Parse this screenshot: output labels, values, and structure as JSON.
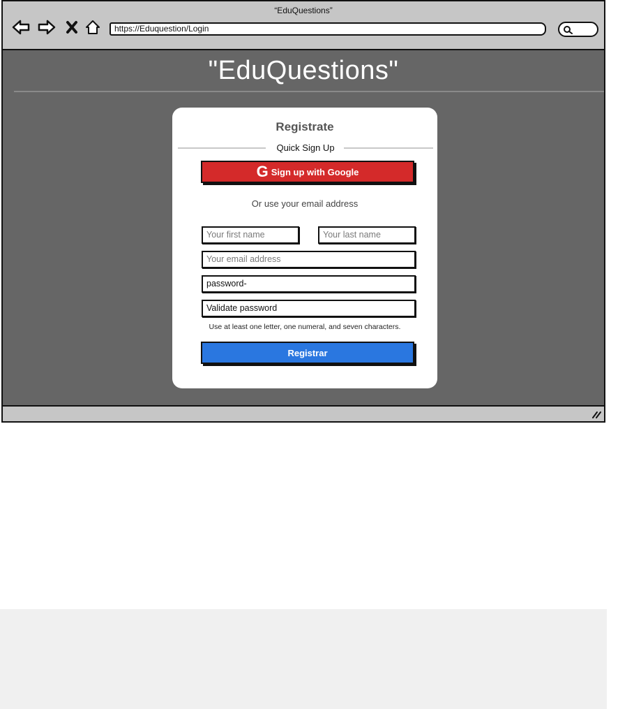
{
  "window": {
    "title": "“EduQuestions”"
  },
  "toolbar": {
    "back_icon": "arrow-left-icon",
    "forward_icon": "arrow-right-icon",
    "close_icon": "x-icon",
    "home_icon": "home-icon",
    "url": "https://Eduquestion/Login",
    "search_icon": "search-icon"
  },
  "page": {
    "heading": "\"EduQuestions\""
  },
  "form": {
    "title": "Registrate",
    "quick_signup": "Quick Sign Up",
    "google_icon_glyph": "G",
    "google_button": "Sign up with Google",
    "alt_text": "Or use your email address",
    "first_name_placeholder": "Your first name",
    "last_name_placeholder": "Your last name",
    "email_placeholder": "Your email address",
    "password_value": "password-",
    "validate_password_value": "Validate password",
    "hint": "Use at least one letter, one numeral, and seven characters.",
    "submit": "Registrar"
  },
  "colors": {
    "chrome": "#c6c6c6",
    "page_background": "#666666",
    "google_button": "#d42a2a",
    "submit_button": "#2a77e0",
    "card": "#ffffff",
    "bottom_panel": "#f0f0f0"
  }
}
